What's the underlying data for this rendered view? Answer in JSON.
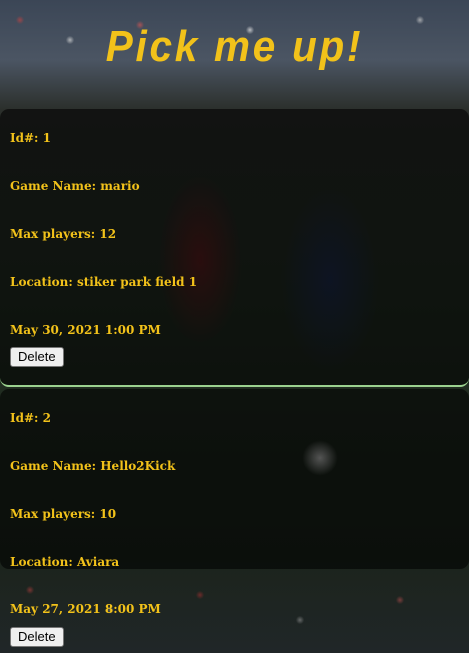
{
  "header": {
    "title": "Pick me up!"
  },
  "games": [
    {
      "id_label": "Id#: 1",
      "name_label": "Game Name: mario",
      "max_players_label": "Max players: 12",
      "location_label": "Location: stiker park field 1",
      "datetime": "May 30, 2021 1:00 PM",
      "delete_label": "Delete"
    },
    {
      "id_label": "Id#: 2",
      "name_label": "Game Name: Hello2Kick",
      "max_players_label": "Max players: 10",
      "location_label": "Location: Aviara",
      "datetime": "May 27, 2021 8:00 PM",
      "delete_label": "Delete"
    }
  ],
  "colors": {
    "accent": "#f2c21a",
    "card_border": "#9bd28f"
  }
}
